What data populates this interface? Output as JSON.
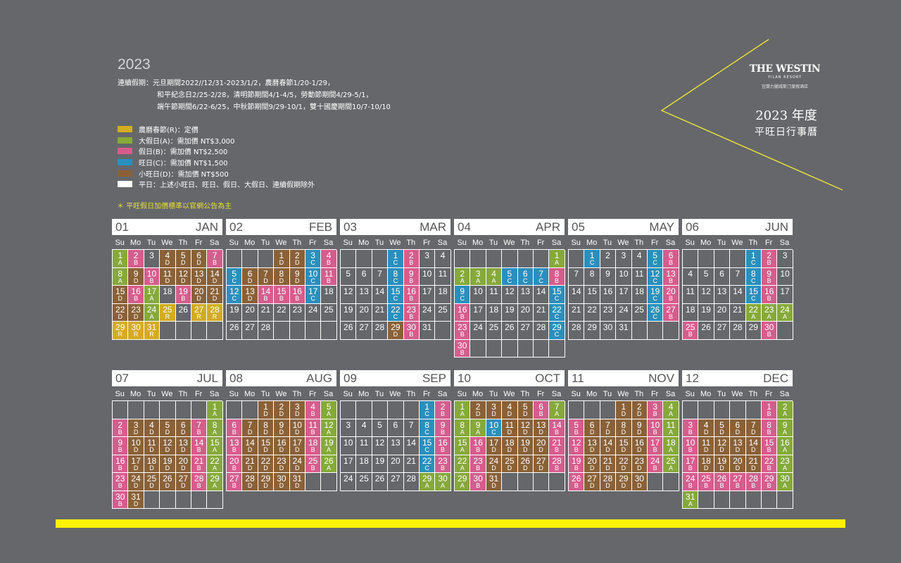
{
  "year": "2023",
  "continuous_holidays": [
    "連續假期：元旦期間2022//12/31-2023/1/2，農曆春節1/20-1/29，",
    "和平紀念日2/25-2/28，清明節期間4/1-4/5，勞動節期間4/29-5/1，",
    "端午節期間6/22-6/25，中秋節期間9/29-10/1，雙十國慶期間10/7-10/10"
  ],
  "legend": [
    {
      "color": "#d4ab20",
      "label": "農曆春節(R)：定價"
    },
    {
      "color": "#86a93a",
      "label": "大假日(A)：需加價 NT$3,000"
    },
    {
      "color": "#d55d8c",
      "label": "假日(B)：需加價 NT$2,500"
    },
    {
      "color": "#2a8fbd",
      "label": "旺日(C)：需加價 NT$1,500"
    },
    {
      "color": "#8a6137",
      "label": "小旺日(D)：需加價 NT$500"
    },
    {
      "color": "#ffffff",
      "label": "平日：上述小旺日、旺日、假日、大假日、連續假期除外"
    }
  ],
  "note": "＊ 平旺假日加價標準以官網公告為主",
  "brand": {
    "name": "THE WESTIN",
    "sub": "YILAN RESORT",
    "zh": "宜蘭力麗威斯汀度假酒店"
  },
  "title": {
    "line1": "2023 年度",
    "line2": "平旺日行事曆"
  },
  "weekdays": [
    "Su",
    "Mo",
    "Tu",
    "We",
    "Th",
    "Fr",
    "Sa"
  ],
  "colors": {
    "R": "#d4ab20",
    "A": "#86a93a",
    "B": "#d55d8c",
    "C": "#2a8fbd",
    "D": "#8a6137"
  },
  "months": [
    {
      "num": "01",
      "name": "JAN",
      "start": 0,
      "days": 31,
      "codes": "AB DDDBADBDDDDDBA BDDDDAR RRRRRAA BDD"
    },
    {
      "num": "02",
      "name": "FEB",
      "start": 3,
      "days": 28,
      "codes": "DDCBCDDDDCBCDBBBC"
    },
    {
      "num": "03",
      "name": "MAR",
      "start": 3,
      "days": 31,
      "codes": "CB-----CB-----CB-----CB-----DB----C"
    },
    {
      "num": "04",
      "name": "APR",
      "start": 6,
      "days": 30,
      "codes": "AAAACCCBC-----CB-----CB-----CB-----CAA"
    },
    {
      "num": "05",
      "name": "MAY",
      "start": 1,
      "days": 31,
      "codes": "C---CB-----CB-----CB-----CB----"
    },
    {
      "num": "06",
      "name": "JUN",
      "start": 4,
      "days": 30,
      "codes": "CB-----CB-----CB-----AAAB----B"
    },
    {
      "num": "07",
      "name": "JUL",
      "start": 6,
      "days": 31,
      "codes": "ABDDDDBABDDDDBABDDDDBABDDDDBABD"
    },
    {
      "num": "08",
      "name": "AUG",
      "start": 2,
      "days": 31,
      "codes": "DDDBABDDDDBABDDDDBABDDDDBABDDDD"
    },
    {
      "num": "09",
      "name": "SEP",
      "start": 5,
      "days": 30,
      "codes": "CB-----CB-----CB-----CB-----AA"
    },
    {
      "num": "10",
      "name": "OCT",
      "start": 0,
      "days": 31,
      "codes": "ADDDDBAAACDDDBABDDDDBABDDDDBABDD"
    },
    {
      "num": "11",
      "name": "NOV",
      "start": 3,
      "days": 30,
      "codes": "DDBABDDDDBABDDDDBABDDDDBABDDDD"
    },
    {
      "num": "12",
      "name": "DEC",
      "start": 5,
      "days": 31,
      "codes": "BABDDDDBABDDDDBABDDDDBABBBBBBAA"
    }
  ]
}
